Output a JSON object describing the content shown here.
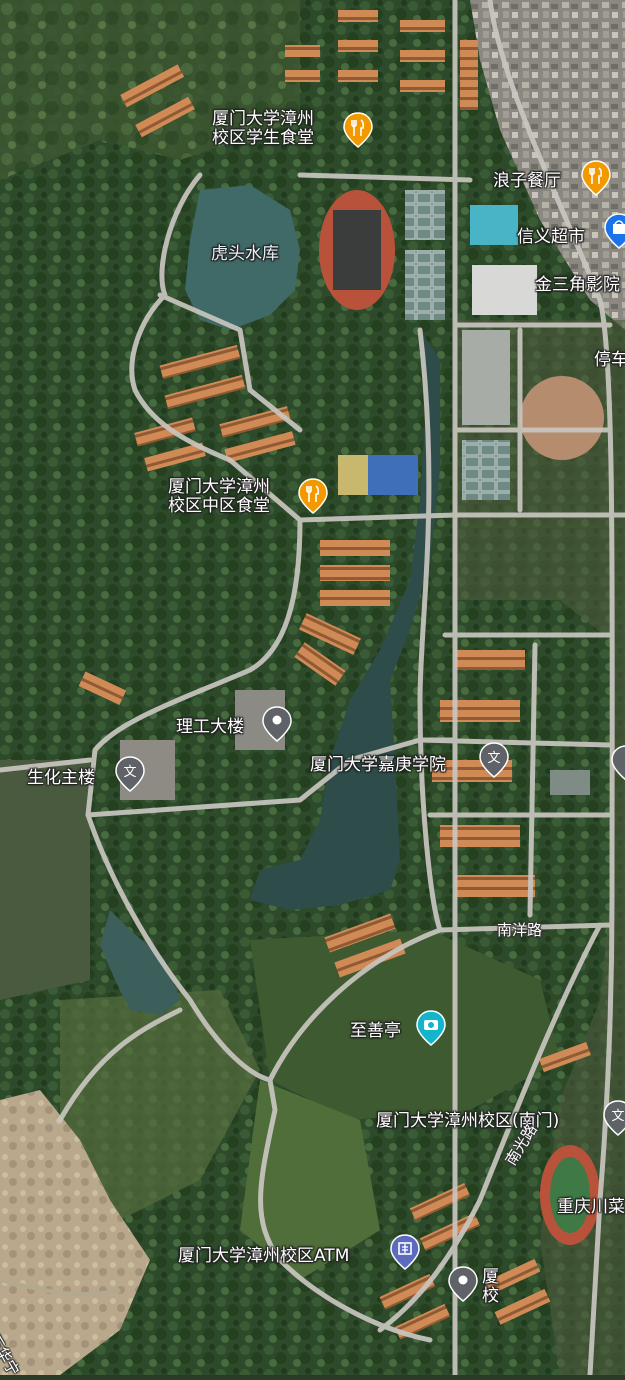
{
  "map": {
    "pois": [
      {
        "id": "student-canteen",
        "line1": "厦门大学漳州",
        "line2": "校区学生食堂",
        "icon": "restaurant-icon",
        "color": "#f29900"
      },
      {
        "id": "langzi-restaurant",
        "line1": "浪子餐厅",
        "icon": "restaurant-icon",
        "color": "#f29900"
      },
      {
        "id": "xinyi-supermarket",
        "line1": "信义超市",
        "icon": "shopping-icon",
        "color": "#1a73e8"
      },
      {
        "id": "jinsanjiao-cinema",
        "line1": "金三角影院",
        "icon": "",
        "color": ""
      },
      {
        "id": "parking",
        "line1": "停车",
        "icon": "",
        "color": ""
      },
      {
        "id": "huotou-reservoir",
        "line1": "虎头水库",
        "icon": "",
        "color": ""
      },
      {
        "id": "central-canteen",
        "line1": "厦门大学漳州",
        "line2": "校区中区食堂",
        "icon": "restaurant-icon",
        "color": "#f29900"
      },
      {
        "id": "science-building",
        "line1": "理工大楼",
        "icon": "place-icon",
        "color": "#5f6368"
      },
      {
        "id": "biochem-building",
        "line1": "生化主楼",
        "icon": "school-icon",
        "color": "#5f6368"
      },
      {
        "id": "jiageng-college",
        "line1": "厦门大学嘉庚学院",
        "icon": "school-icon",
        "color": "#5f6368"
      },
      {
        "id": "zhishan-pavilion",
        "line1": "至善亭",
        "icon": "camera-icon",
        "color": "#12b5cb"
      },
      {
        "id": "south-gate",
        "line1": "厦门大学漳州校区(南门)",
        "icon": "school-icon",
        "color": "#5f6368"
      },
      {
        "id": "chongqing-restaurant",
        "line1": "重庆川菜",
        "icon": "",
        "color": ""
      },
      {
        "id": "atm",
        "line1": "厦门大学漳州校区ATM",
        "icon": "bank-icon",
        "color": "#5c6bc0"
      },
      {
        "id": "campus-place",
        "line1": "厦",
        "line2": "校",
        "icon": "place-icon",
        "color": "#5f6368"
      }
    ],
    "roads": [
      {
        "id": "nanyang-road",
        "label": "南洋路"
      },
      {
        "id": "nanguang-road",
        "label": "南光路"
      },
      {
        "id": "bottom-left-road",
        "label": "石华宁"
      }
    ]
  }
}
